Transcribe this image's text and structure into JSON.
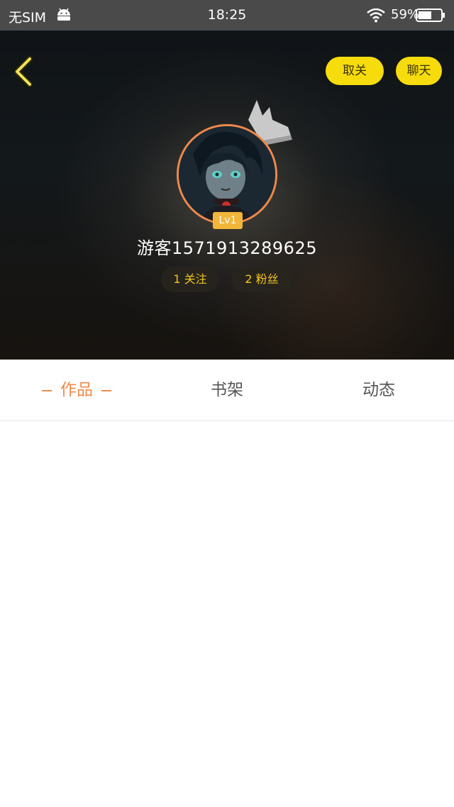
{
  "status_bar": {
    "carrier": "无SIM",
    "time": "18:25",
    "battery": "59%"
  },
  "header": {
    "unfollow_label": "取关",
    "chat_label": "聊天",
    "level": "Lv1",
    "username": "游客1571913289625",
    "following_label": "1 关注",
    "fans_label": "2 粉丝"
  },
  "tabs": [
    {
      "label": "作品",
      "active": true
    },
    {
      "label": "书架",
      "active": false
    },
    {
      "label": "动态",
      "active": false
    }
  ],
  "colors": {
    "accent_yellow": "#f7dc0d",
    "accent_orange": "#f08a4b",
    "level_badge": "#f2b63a"
  }
}
